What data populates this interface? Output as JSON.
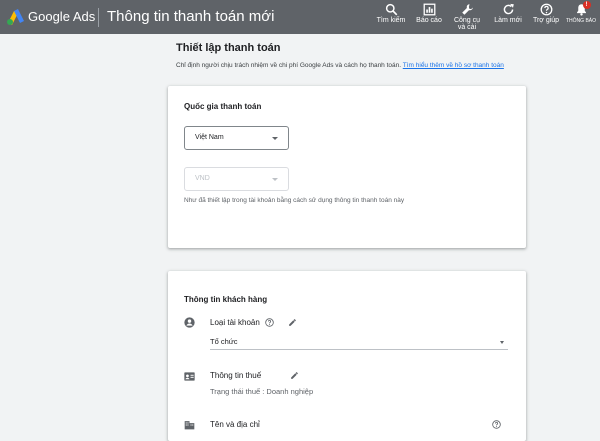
{
  "header": {
    "brand": "Google Ads",
    "page_title": "Thông tin thanh toán mới",
    "tools": [
      {
        "label": "Tìm kiếm",
        "icon": "search-icon"
      },
      {
        "label": "Báo cáo",
        "icon": "reports-icon"
      },
      {
        "label": "Công cụ và cài",
        "icon": "tools-icon"
      },
      {
        "label": "Làm mới",
        "icon": "refresh-icon"
      },
      {
        "label": "Trợ giúp",
        "icon": "help-icon"
      },
      {
        "label": "THÔNG BÁO",
        "icon": "bell-icon",
        "badge": "!"
      }
    ]
  },
  "setup": {
    "title": "Thiết lập thanh toán",
    "description": "Chỉ định người chịu trách nhiệm về chi phí Google Ads và cách họ thanh toán.",
    "learn_more": "Tìm hiểu thêm về hồ sơ thanh toán"
  },
  "country_card": {
    "heading": "Quốc gia thanh toán",
    "country": "Việt Nam",
    "currency": "VND",
    "hint": "Như đã thiết lập trong tài khoản bằng cách sử dụng thông tin thanh toán này"
  },
  "customer_card": {
    "heading": "Thông tin khách hàng",
    "account_type_label": "Loại tài khoản",
    "account_type_value": "Tổ chức",
    "tax_label": "Thông tin thuế",
    "tax_status": "Trạng thái thuế : Doanh nghiệp",
    "name_address_label": "Tên và địa chỉ"
  },
  "colors": {
    "topbar": "#5f6368",
    "link": "#1a73e8",
    "badge": "#d93025",
    "background": "#f1f3f4"
  }
}
